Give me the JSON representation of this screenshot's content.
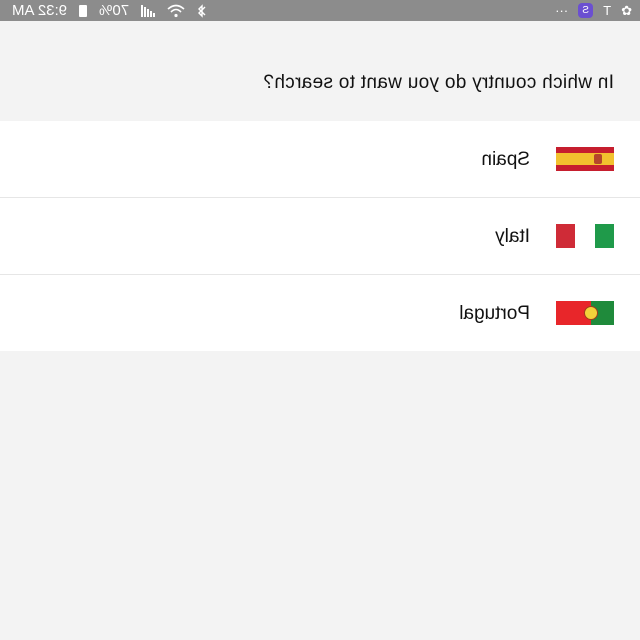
{
  "status_bar": {
    "time": "9:32 AM",
    "battery": "70%",
    "overflow": "···",
    "carrier_glyph": "T",
    "app_badge_glyph": "S",
    "icons": [
      "pinwheel-icon",
      "carrier-icon",
      "app-badge-icon",
      "overflow-icon",
      "bluetooth-icon",
      "wifi-icon",
      "signal-icon",
      "battery-icon"
    ]
  },
  "header": {
    "question": "In which country do you want to search?"
  },
  "countries": [
    {
      "name": "Spain",
      "flag": "spain-flag-icon",
      "colors": [
        "#c61e2e",
        "#f2c12e"
      ]
    },
    {
      "name": "Italy",
      "flag": "italy-flag-icon",
      "colors": [
        "#1f9a4a",
        "#ffffff",
        "#cf2b37"
      ]
    },
    {
      "name": "Portugal",
      "flag": "portugal-flag-icon",
      "colors": [
        "#1f8a3b",
        "#e8262a"
      ]
    }
  ],
  "colors": {
    "status_bar_bg": "#8c8c8c",
    "page_bg": "#f3f3f3",
    "list_bg": "#ffffff",
    "divider": "#e6e6e6",
    "text": "#111111"
  }
}
